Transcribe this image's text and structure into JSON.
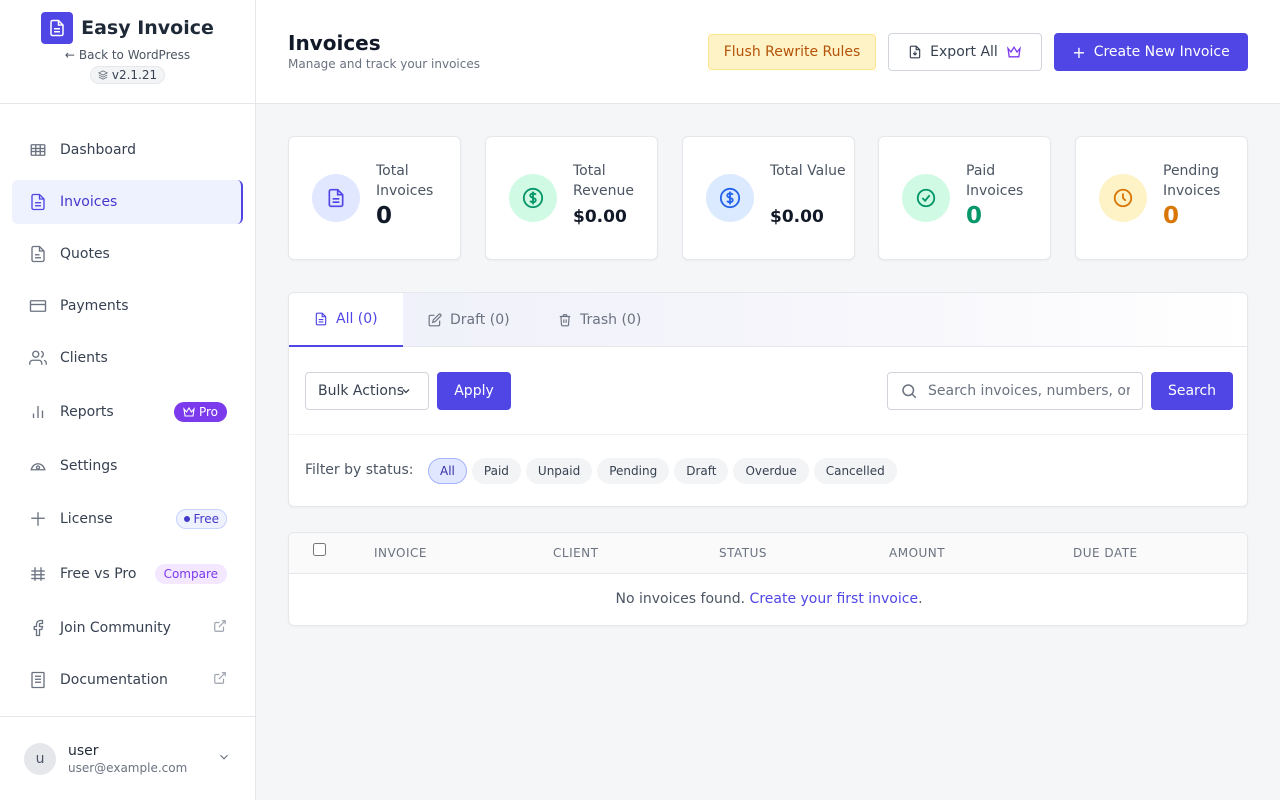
{
  "brand": {
    "title": "Easy Invoice",
    "back_label": "Back to WordPress",
    "version": "v2.1.21"
  },
  "nav": {
    "items": [
      {
        "label": "Dashboard",
        "icon": "grid-icon"
      },
      {
        "label": "Invoices",
        "icon": "document-icon",
        "active": true
      },
      {
        "label": "Quotes",
        "icon": "quote-document-icon"
      },
      {
        "label": "Payments",
        "icon": "credit-card-icon"
      },
      {
        "label": "Clients",
        "icon": "users-icon"
      },
      {
        "label": "Reports",
        "icon": "bar-chart-icon",
        "badge": "Pro"
      },
      {
        "label": "Settings",
        "icon": "settings-icon"
      },
      {
        "label": "License",
        "icon": "sparkle-icon",
        "badge": "Free"
      },
      {
        "label": "Free vs Pro",
        "icon": "hash-grid-icon",
        "badge": "Compare"
      },
      {
        "label": "Join Community",
        "icon": "facebook-icon"
      },
      {
        "label": "Documentation",
        "icon": "book-icon"
      }
    ]
  },
  "user": {
    "avatar_initial": "u",
    "name": "user",
    "email": "user@example.com"
  },
  "header": {
    "title": "Invoices",
    "subtitle": "Manage and track your invoices",
    "flush_label": "Flush Rewrite Rules",
    "export_label": "Export All",
    "create_label": "Create New Invoice"
  },
  "stats": [
    {
      "label": "Total Invoices",
      "value": "0",
      "color": "#111827",
      "icon_bg": "#e0e7ff",
      "icon_color": "#4f46e5"
    },
    {
      "label": "Total Revenue",
      "value": "$0.00",
      "color": "#111827",
      "icon_bg": "#d1fae5",
      "icon_color": "#059669"
    },
    {
      "label": "Total Value",
      "value": "$0.00",
      "color": "#111827",
      "icon_bg": "#dbeafe",
      "icon_color": "#2563eb"
    },
    {
      "label": "Paid Invoices",
      "value": "0",
      "color": "#059669",
      "icon_bg": "#d1fae5",
      "icon_color": "#059669"
    },
    {
      "label": "Pending Invoices",
      "value": "0",
      "color": "#d97706",
      "icon_bg": "#fef3c7",
      "icon_color": "#d97706"
    }
  ],
  "tabs": [
    {
      "label": "All (0)",
      "active": true
    },
    {
      "label": "Draft (0)"
    },
    {
      "label": "Trash (0)"
    }
  ],
  "toolbar": {
    "bulk_selected": "Bulk Actions",
    "apply_label": "Apply",
    "search_placeholder": "Search invoices, numbers, or clients...",
    "search_value": "",
    "search_label": "Search"
  },
  "filter": {
    "label": "Filter by status:",
    "chips": [
      "All",
      "Paid",
      "Unpaid",
      "Pending",
      "Draft",
      "Overdue",
      "Cancelled"
    ],
    "active": "All"
  },
  "table": {
    "columns": [
      "INVOICE",
      "CLIENT",
      "STATUS",
      "AMOUNT",
      "DUE DATE"
    ],
    "empty_text": "No invoices found.",
    "empty_link": "Create your first invoice",
    "empty_suffix": "."
  },
  "colors": {
    "accent": "#4f46e5",
    "pro_badge": "#7c3aed",
    "warning_bg": "#fef3c7"
  }
}
